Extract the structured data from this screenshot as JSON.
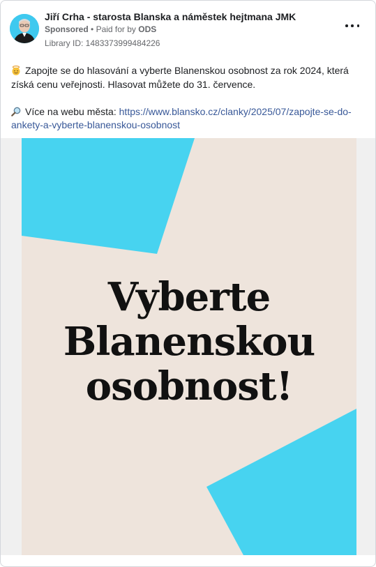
{
  "post": {
    "author": "Jiří Crha - starosta Blanska a náměstek hejtmana JMK",
    "sponsored_label": "Sponsored",
    "separator": "•",
    "paid_prefix": "Paid for by",
    "paid_by": "ODS",
    "library_id": "Library ID: 1483373999484226",
    "text_line1": "Zapojte se do hlasování a vyberte Blanenskou osobnost za rok 2024, která získá cenu veřejnosti. Hlasovat můžete do 31. července.",
    "text_line2_prefix": "Více na webu města:",
    "link": "https://www.blansko.cz/clanky/2025/07/zapojte-se-do-ankety-a-vyberte-blanenskou-osobnost",
    "icons": {
      "emoji1": "angel-emoji-icon",
      "emoji2": "magnifier-emoji-icon",
      "more": "more-options-icon"
    }
  },
  "poster": {
    "line1": "Vyberte",
    "line2": "Blanenskou",
    "line3": "osobnost!",
    "colors": {
      "background": "#eee4dc",
      "accent": "#47d3f0"
    }
  }
}
